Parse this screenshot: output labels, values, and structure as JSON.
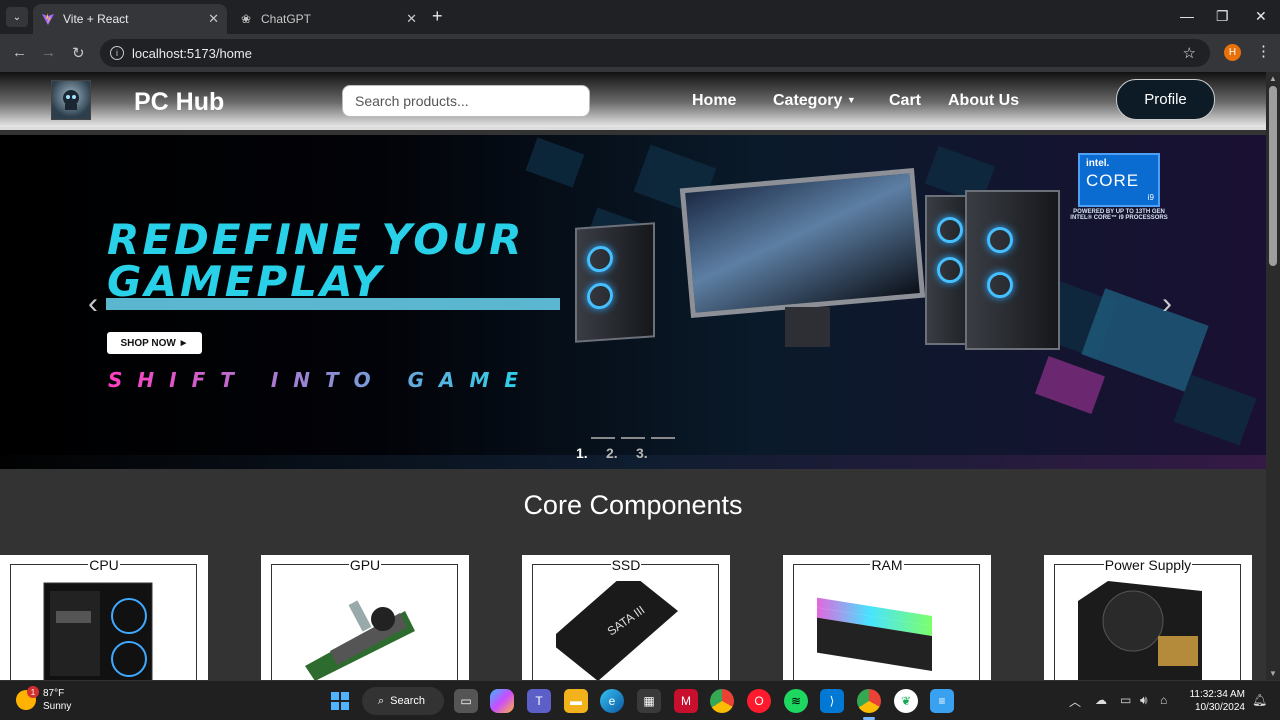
{
  "browser": {
    "tabs": [
      {
        "title": "Vite + React",
        "active": true
      },
      {
        "title": "ChatGPT",
        "active": false
      }
    ],
    "url": "localhost:5173/home",
    "profile_initial": "H"
  },
  "site": {
    "brand": "PC Hub",
    "search_placeholder": "Search products...",
    "nav": [
      "Home",
      "Category",
      "Cart",
      "About Us"
    ],
    "profile_label": "Profile"
  },
  "banner": {
    "headline_line1": "REDEFINE YOUR",
    "headline_line2": "GAMEPLAY",
    "shop_button": "SHOP NOW ►",
    "tagline": "SHIFT INTO GAME",
    "intel_brand": "intel.",
    "intel_product": "CORE",
    "intel_tier": "i9",
    "intel_note": "POWERED BY UP TO 13TH GEN INTEL® CORE™ i9 PROCESSORS",
    "indicators": [
      "1.",
      "2.",
      "3."
    ],
    "active_index": 0
  },
  "section": {
    "title": "Core Components",
    "cards": [
      {
        "label": "CPU"
      },
      {
        "label": "GPU"
      },
      {
        "label": "SSD"
      },
      {
        "label": "RAM"
      },
      {
        "label": "Power Supply"
      }
    ]
  },
  "taskbar": {
    "weather_temp": "87°F",
    "weather_desc": "Sunny",
    "weather_badge": "1",
    "search_label": "Search",
    "time": "11:32:34 AM",
    "date": "10/30/2024"
  }
}
